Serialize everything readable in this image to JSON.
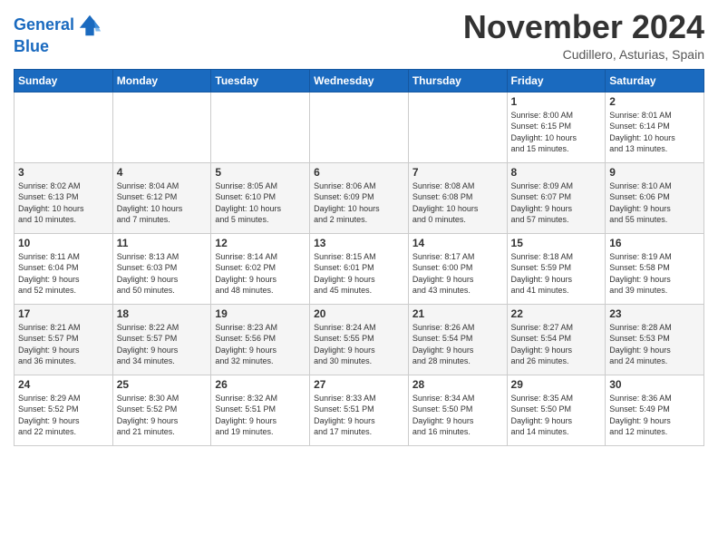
{
  "header": {
    "logo_line1": "General",
    "logo_line2": "Blue",
    "month": "November 2024",
    "location": "Cudillero, Asturias, Spain"
  },
  "days_of_week": [
    "Sunday",
    "Monday",
    "Tuesday",
    "Wednesday",
    "Thursday",
    "Friday",
    "Saturday"
  ],
  "weeks": [
    [
      {
        "day": "",
        "info": ""
      },
      {
        "day": "",
        "info": ""
      },
      {
        "day": "",
        "info": ""
      },
      {
        "day": "",
        "info": ""
      },
      {
        "day": "",
        "info": ""
      },
      {
        "day": "1",
        "info": "Sunrise: 8:00 AM\nSunset: 6:15 PM\nDaylight: 10 hours\nand 15 minutes."
      },
      {
        "day": "2",
        "info": "Sunrise: 8:01 AM\nSunset: 6:14 PM\nDaylight: 10 hours\nand 13 minutes."
      }
    ],
    [
      {
        "day": "3",
        "info": "Sunrise: 8:02 AM\nSunset: 6:13 PM\nDaylight: 10 hours\nand 10 minutes."
      },
      {
        "day": "4",
        "info": "Sunrise: 8:04 AM\nSunset: 6:12 PM\nDaylight: 10 hours\nand 7 minutes."
      },
      {
        "day": "5",
        "info": "Sunrise: 8:05 AM\nSunset: 6:10 PM\nDaylight: 10 hours\nand 5 minutes."
      },
      {
        "day": "6",
        "info": "Sunrise: 8:06 AM\nSunset: 6:09 PM\nDaylight: 10 hours\nand 2 minutes."
      },
      {
        "day": "7",
        "info": "Sunrise: 8:08 AM\nSunset: 6:08 PM\nDaylight: 10 hours\nand 0 minutes."
      },
      {
        "day": "8",
        "info": "Sunrise: 8:09 AM\nSunset: 6:07 PM\nDaylight: 9 hours\nand 57 minutes."
      },
      {
        "day": "9",
        "info": "Sunrise: 8:10 AM\nSunset: 6:06 PM\nDaylight: 9 hours\nand 55 minutes."
      }
    ],
    [
      {
        "day": "10",
        "info": "Sunrise: 8:11 AM\nSunset: 6:04 PM\nDaylight: 9 hours\nand 52 minutes."
      },
      {
        "day": "11",
        "info": "Sunrise: 8:13 AM\nSunset: 6:03 PM\nDaylight: 9 hours\nand 50 minutes."
      },
      {
        "day": "12",
        "info": "Sunrise: 8:14 AM\nSunset: 6:02 PM\nDaylight: 9 hours\nand 48 minutes."
      },
      {
        "day": "13",
        "info": "Sunrise: 8:15 AM\nSunset: 6:01 PM\nDaylight: 9 hours\nand 45 minutes."
      },
      {
        "day": "14",
        "info": "Sunrise: 8:17 AM\nSunset: 6:00 PM\nDaylight: 9 hours\nand 43 minutes."
      },
      {
        "day": "15",
        "info": "Sunrise: 8:18 AM\nSunset: 5:59 PM\nDaylight: 9 hours\nand 41 minutes."
      },
      {
        "day": "16",
        "info": "Sunrise: 8:19 AM\nSunset: 5:58 PM\nDaylight: 9 hours\nand 39 minutes."
      }
    ],
    [
      {
        "day": "17",
        "info": "Sunrise: 8:21 AM\nSunset: 5:57 PM\nDaylight: 9 hours\nand 36 minutes."
      },
      {
        "day": "18",
        "info": "Sunrise: 8:22 AM\nSunset: 5:57 PM\nDaylight: 9 hours\nand 34 minutes."
      },
      {
        "day": "19",
        "info": "Sunrise: 8:23 AM\nSunset: 5:56 PM\nDaylight: 9 hours\nand 32 minutes."
      },
      {
        "day": "20",
        "info": "Sunrise: 8:24 AM\nSunset: 5:55 PM\nDaylight: 9 hours\nand 30 minutes."
      },
      {
        "day": "21",
        "info": "Sunrise: 8:26 AM\nSunset: 5:54 PM\nDaylight: 9 hours\nand 28 minutes."
      },
      {
        "day": "22",
        "info": "Sunrise: 8:27 AM\nSunset: 5:54 PM\nDaylight: 9 hours\nand 26 minutes."
      },
      {
        "day": "23",
        "info": "Sunrise: 8:28 AM\nSunset: 5:53 PM\nDaylight: 9 hours\nand 24 minutes."
      }
    ],
    [
      {
        "day": "24",
        "info": "Sunrise: 8:29 AM\nSunset: 5:52 PM\nDaylight: 9 hours\nand 22 minutes."
      },
      {
        "day": "25",
        "info": "Sunrise: 8:30 AM\nSunset: 5:52 PM\nDaylight: 9 hours\nand 21 minutes."
      },
      {
        "day": "26",
        "info": "Sunrise: 8:32 AM\nSunset: 5:51 PM\nDaylight: 9 hours\nand 19 minutes."
      },
      {
        "day": "27",
        "info": "Sunrise: 8:33 AM\nSunset: 5:51 PM\nDaylight: 9 hours\nand 17 minutes."
      },
      {
        "day": "28",
        "info": "Sunrise: 8:34 AM\nSunset: 5:50 PM\nDaylight: 9 hours\nand 16 minutes."
      },
      {
        "day": "29",
        "info": "Sunrise: 8:35 AM\nSunset: 5:50 PM\nDaylight: 9 hours\nand 14 minutes."
      },
      {
        "day": "30",
        "info": "Sunrise: 8:36 AM\nSunset: 5:49 PM\nDaylight: 9 hours\nand 12 minutes."
      }
    ]
  ]
}
